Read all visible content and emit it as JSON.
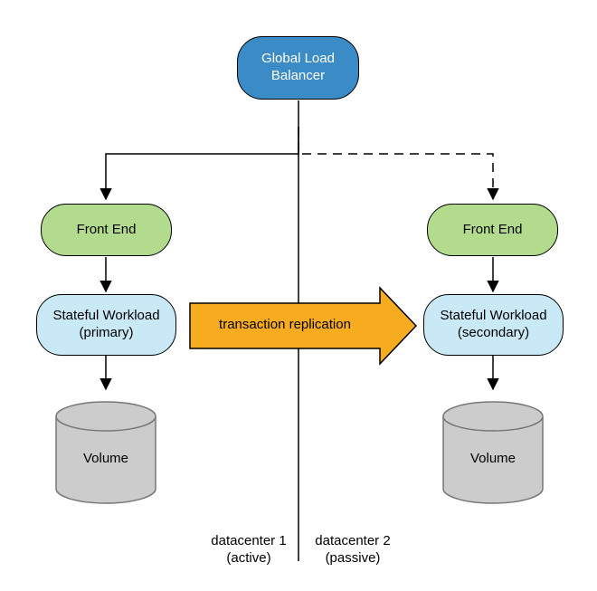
{
  "nodes": {
    "glb": "Global Load\nBalancer",
    "fe_left": "Front End",
    "fe_right": "Front End",
    "workload_left": "Stateful Workload\n(primary)",
    "workload_right": "Stateful Workload\n(secondary)",
    "volume_left": "Volume",
    "volume_right": "Volume"
  },
  "arrow_label": "transaction replication",
  "dc_labels": {
    "left": "datacenter 1\n(active)",
    "right": "datacenter 2\n(passive)"
  },
  "colors": {
    "glb": "#3b8bc6",
    "frontend": "#b3db8e",
    "workload": "#cae9f7",
    "volume_fill": "#cccccc",
    "volume_stroke": "#777777",
    "tx_arrow": "#f6ac1e",
    "tx_arrow_stroke": "#000000"
  }
}
